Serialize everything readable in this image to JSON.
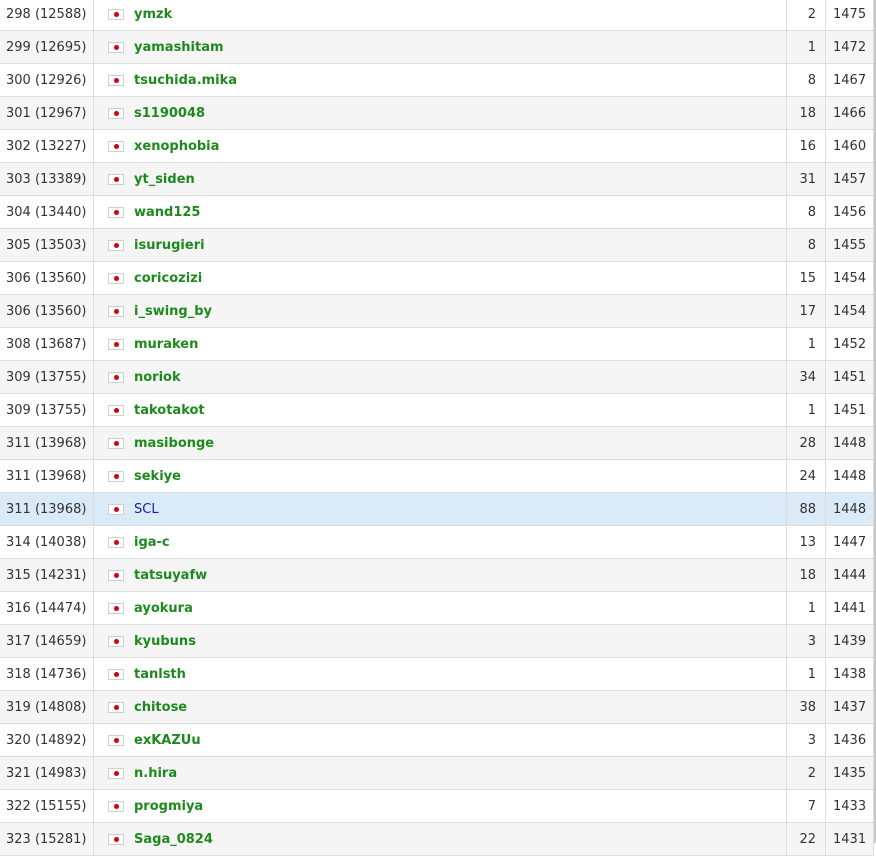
{
  "rows": [
    {
      "rank": "298 (12588)",
      "user": "ymzk",
      "count": "2",
      "rating": "1475"
    },
    {
      "rank": "299 (12695)",
      "user": "yamashitam",
      "count": "1",
      "rating": "1472"
    },
    {
      "rank": "300 (12926)",
      "user": "tsuchida.mika",
      "count": "8",
      "rating": "1467"
    },
    {
      "rank": "301 (12967)",
      "user": "s1190048",
      "count": "18",
      "rating": "1466"
    },
    {
      "rank": "302 (13227)",
      "user": "xenophobia",
      "count": "16",
      "rating": "1460"
    },
    {
      "rank": "303 (13389)",
      "user": "yt_siden",
      "count": "31",
      "rating": "1457"
    },
    {
      "rank": "304 (13440)",
      "user": "wand125",
      "count": "8",
      "rating": "1456"
    },
    {
      "rank": "305 (13503)",
      "user": "isurugieri",
      "count": "8",
      "rating": "1455"
    },
    {
      "rank": "306 (13560)",
      "user": "coricozizi",
      "count": "15",
      "rating": "1454"
    },
    {
      "rank": "306 (13560)",
      "user": "i_swing_by",
      "count": "17",
      "rating": "1454"
    },
    {
      "rank": "308 (13687)",
      "user": "muraken",
      "count": "1",
      "rating": "1452"
    },
    {
      "rank": "309 (13755)",
      "user": "noriok",
      "count": "34",
      "rating": "1451"
    },
    {
      "rank": "309 (13755)",
      "user": "takotakot",
      "count": "1",
      "rating": "1451"
    },
    {
      "rank": "311 (13968)",
      "user": "masibonge",
      "count": "28",
      "rating": "1448"
    },
    {
      "rank": "311 (13968)",
      "user": "sekiye",
      "count": "24",
      "rating": "1448"
    },
    {
      "rank": "311 (13968)",
      "user": "SCL",
      "count": "88",
      "rating": "1448",
      "highlight": true
    },
    {
      "rank": "314 (14038)",
      "user": "iga-c",
      "count": "13",
      "rating": "1447"
    },
    {
      "rank": "315 (14231)",
      "user": "tatsuyafw",
      "count": "18",
      "rating": "1444"
    },
    {
      "rank": "316 (14474)",
      "user": "ayokura",
      "count": "1",
      "rating": "1441"
    },
    {
      "rank": "317 (14659)",
      "user": "kyubuns",
      "count": "3",
      "rating": "1439"
    },
    {
      "rank": "318 (14736)",
      "user": "tanlsth",
      "count": "1",
      "rating": "1438"
    },
    {
      "rank": "319 (14808)",
      "user": "chitose",
      "count": "38",
      "rating": "1437"
    },
    {
      "rank": "320 (14892)",
      "user": "exKAZUu",
      "count": "3",
      "rating": "1436"
    },
    {
      "rank": "321 (14983)",
      "user": "n.hira",
      "count": "2",
      "rating": "1435"
    },
    {
      "rank": "322 (15155)",
      "user": "progmiya",
      "count": "7",
      "rating": "1433"
    },
    {
      "rank": "323 (15281)",
      "user": "Saga_0824",
      "count": "22",
      "rating": "1431"
    }
  ],
  "colors": {
    "username": "#1e8a1e",
    "username_highlight": "#1b1bb8",
    "row_highlight": "#dbeaf7",
    "row_alt": "#f5f5f5",
    "flag_circle": "#d00016"
  },
  "icons": {
    "flag": "japan-flag-icon"
  }
}
